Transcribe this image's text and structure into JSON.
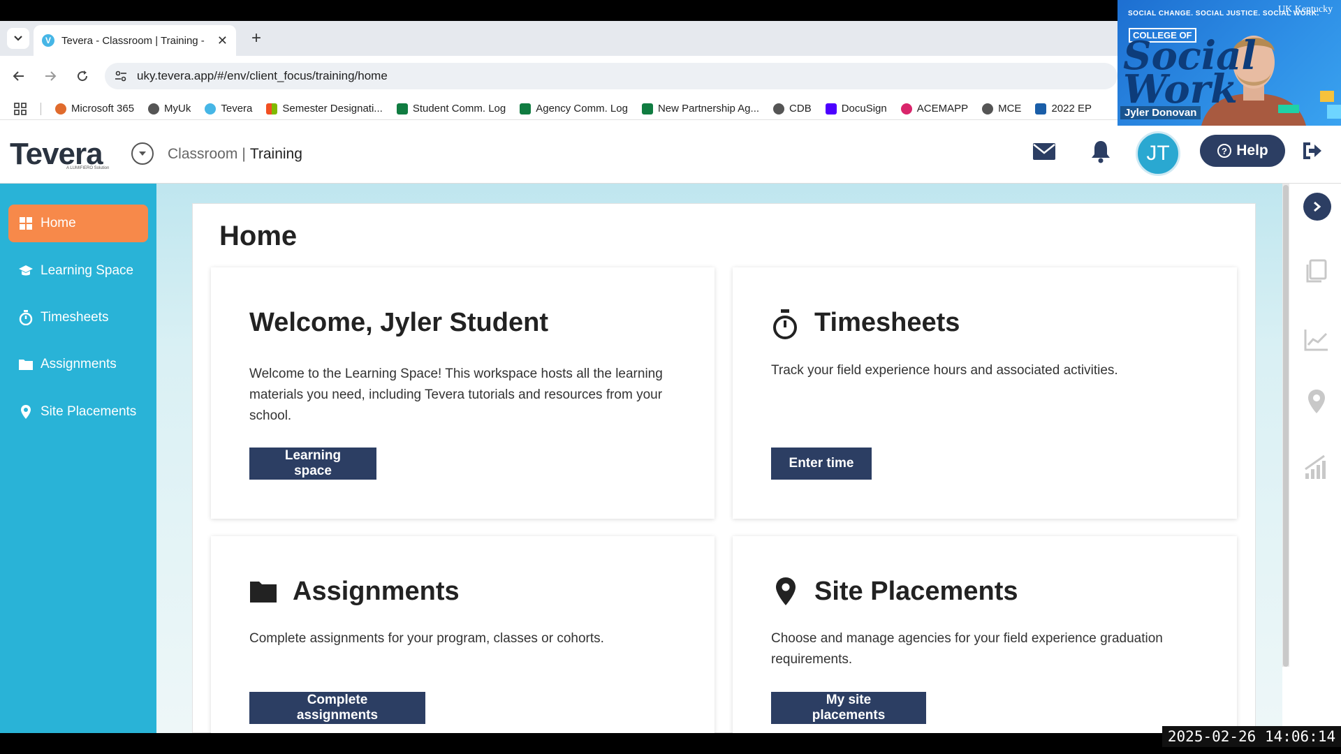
{
  "browser": {
    "tab_title": "Tevera - Classroom | Training - ",
    "tab_favicon": "V",
    "url": "uky.tevera.app/#/env/client_focus/training/home",
    "bookmarks": [
      {
        "label": "Microsoft 365",
        "color": "#e06b2d"
      },
      {
        "label": "MyUk",
        "color": "#555555"
      },
      {
        "label": "Tevera",
        "color": "#46b6e6"
      },
      {
        "label": "Semester Designati...",
        "color": "#f25022"
      },
      {
        "label": "Student Comm. Log",
        "color": "#107c41"
      },
      {
        "label": "Agency Comm. Log",
        "color": "#107c41"
      },
      {
        "label": "New Partnership Ag...",
        "color": "#107c41"
      },
      {
        "label": "CDB",
        "color": "#555555"
      },
      {
        "label": "DocuSign",
        "color": "#4c00ff"
      },
      {
        "label": "ACEMAPP",
        "color": "#d9256b"
      },
      {
        "label": "MCE",
        "color": "#555555"
      },
      {
        "label": "2022 EP",
        "color": "#1a5ea8"
      }
    ]
  },
  "header": {
    "logo": "Tevera",
    "logo_sub": "A LUMIFIERO Solution",
    "breadcrumb_parent": "Classroom",
    "breadcrumb_sep": "|",
    "breadcrumb_current": "Training",
    "avatar_initials": "JT",
    "help_label": "Help"
  },
  "sidebar": {
    "items": [
      {
        "label": "Home",
        "icon": "grid-icon",
        "active": true
      },
      {
        "label": "Learning Space",
        "icon": "graduation-cap-icon"
      },
      {
        "label": "Timesheets",
        "icon": "stopwatch-icon"
      },
      {
        "label": "Assignments",
        "icon": "folder-icon"
      },
      {
        "label": "Site Placements",
        "icon": "map-pin-icon"
      }
    ]
  },
  "main": {
    "page_title": "Home",
    "cards": {
      "welcome": {
        "title": "Welcome, Jyler Student",
        "text": "Welcome to the Learning Space! This workspace hosts all the learning materials you need, including Tevera tutorials and resources from your school.",
        "button": "Learning space"
      },
      "timesheets": {
        "title": "Timesheets",
        "text": "Track your field experience hours and associated activities.",
        "button": "Enter time"
      },
      "assignments": {
        "title": "Assignments",
        "text": "Complete assignments for your program, classes or cohorts.",
        "button": "Complete assignments"
      },
      "placements": {
        "title": "Site Placements",
        "text": "Choose and manage agencies for your field experience graduation requirements.",
        "button": "My site placements"
      }
    }
  },
  "rail": {
    "icons": [
      "documents-icon",
      "line-chart-icon",
      "map-pin-icon",
      "bar-chart-icon"
    ]
  },
  "video": {
    "tagline": "SOCIAL CHANGE. SOCIAL JUSTICE. SOCIAL WORK.",
    "university": "UK Kentucky",
    "college": "COLLEGE OF",
    "script": "Social Work",
    "name": "Jyler Donovan"
  },
  "timestamp": "2025-02-26  14:06:14",
  "colors": {
    "sidebar": "#29b3d7",
    "active": "#f7894a",
    "navy": "#2c3e63",
    "avatar": "#2aa8d1"
  }
}
